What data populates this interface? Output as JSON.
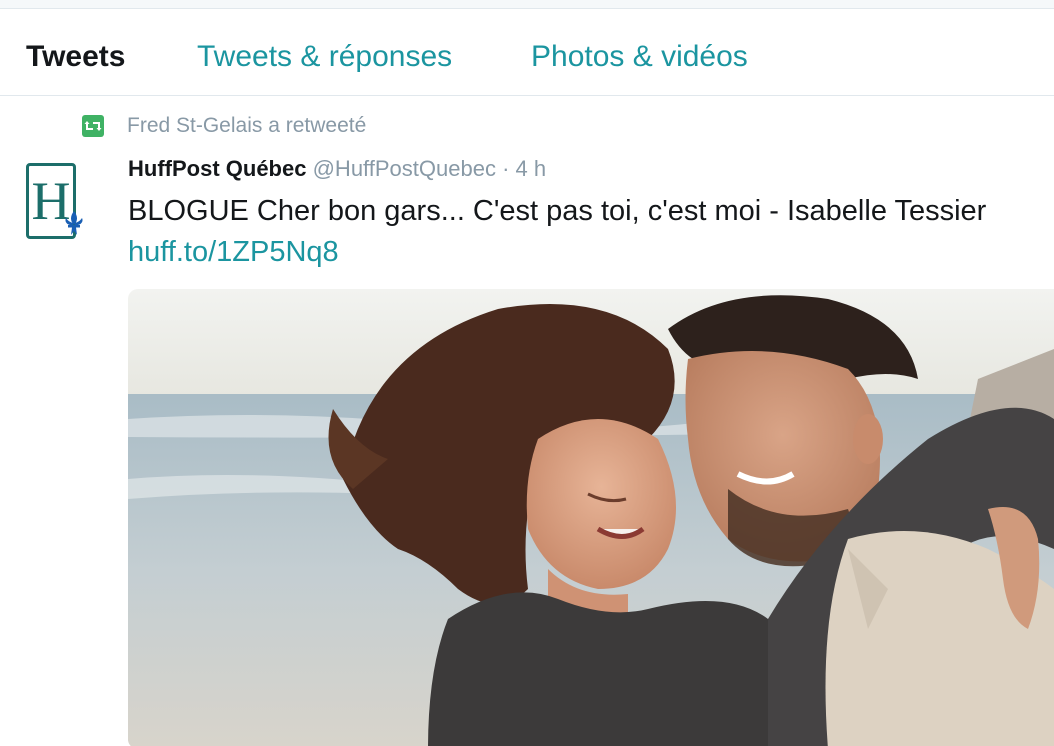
{
  "tabs": [
    {
      "label": "Tweets",
      "active": true
    },
    {
      "label": "Tweets & réponses",
      "active": false
    },
    {
      "label": "Photos & vidéos",
      "active": false
    }
  ],
  "tweet": {
    "retweet_context": "Fred St-Gelais a retweeté",
    "author_name": "HuffPost Québec",
    "author_handle": "@HuffPostQuebec",
    "separator": "·",
    "timestamp": "4 h",
    "avatar_letter": "H",
    "text": "BLOGUE Cher bon gars... C'est pas toi, c'est moi - Isabelle Tessier",
    "link": "huff.to/1ZP5Nq8",
    "media": {
      "icon": "photo-couple-beach"
    }
  },
  "colors": {
    "accent": "#1b95a0",
    "text": "#14171a",
    "muted": "#8899a6",
    "retweet_green": "#3fb264",
    "avatar_teal": "#1c6e6a",
    "fleur_blue": "#1a5fb4"
  }
}
